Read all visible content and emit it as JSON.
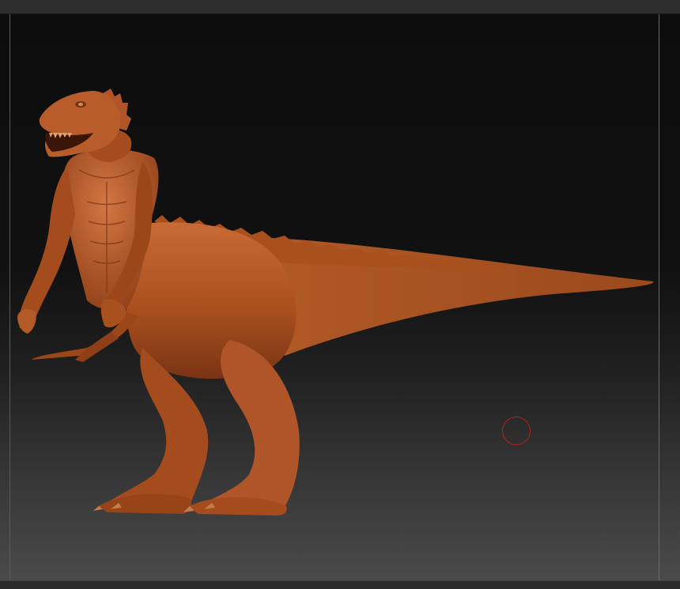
{
  "viewport": {
    "background_top": "#0d0d0d",
    "background_bottom": "#4a4a4a"
  },
  "model": {
    "material_color": "#b5582a",
    "shade_color": "#7a3414",
    "highlight_color": "#d97a44",
    "subject": "dinosaur-centaur-sculpt"
  },
  "brush": {
    "cursor_color": "#b02020",
    "icon": "brush-circle-icon"
  }
}
